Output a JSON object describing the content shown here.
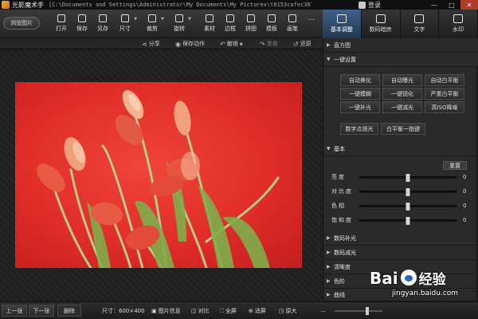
{
  "titlebar": {
    "app_name": "光影魔术手",
    "path": "[C:\\Documents and Settings\\Administrator\\My Documents\\My Pictures\\t0153cafec36754c...",
    "login": "登录",
    "min": "—",
    "max": "□",
    "close": "✕"
  },
  "toolbar": {
    "browse_label": "浏览图片",
    "tools": [
      {
        "label": "打开",
        "icon": "folder-icon"
      },
      {
        "label": "保存",
        "icon": "save-icon"
      },
      {
        "label": "另存",
        "icon": "save-as-icon"
      },
      {
        "label": "尺寸",
        "icon": "resize-icon"
      },
      {
        "label": "裁剪",
        "icon": "crop-icon"
      },
      {
        "label": "旋转",
        "icon": "rotate-icon"
      },
      {
        "label": "素材",
        "icon": "material-icon"
      },
      {
        "label": "边框",
        "icon": "border-icon"
      },
      {
        "label": "拼图",
        "icon": "collage-icon"
      },
      {
        "label": "模板",
        "icon": "template-icon"
      },
      {
        "label": "画笔",
        "icon": "brush-icon"
      },
      {
        "label": "...",
        "icon": "more-icon"
      }
    ]
  },
  "right_tabs": [
    {
      "label": "基本调整",
      "icon": "adjust-icon",
      "active": true
    },
    {
      "label": "数码暗房",
      "icon": "camera-icon",
      "active": false
    },
    {
      "label": "文字",
      "icon": "text-icon",
      "active": false
    },
    {
      "label": "水印",
      "icon": "watermark-icon",
      "active": false
    }
  ],
  "actionbar": {
    "share": "分享",
    "save_action": "保存动作",
    "undo": "撤销",
    "redo": "重做",
    "restore": "还原"
  },
  "panel": {
    "histogram": "直方图",
    "one_click": "一键设置",
    "buttons": [
      "自动美化",
      "自动曝光",
      "自动白平衡",
      "一键模糊",
      "一键锐化",
      "严重白平衡",
      "一键补光",
      "一键减光",
      "高ISO降噪",
      "数字点测光",
      "白平衡一指键"
    ],
    "basic": "基本",
    "reset": "重置",
    "sliders": [
      {
        "label": "亮度",
        "value": 0
      },
      {
        "label": "对比度",
        "value": 0
      },
      {
        "label": "色相",
        "value": 0
      },
      {
        "label": "饱和度",
        "value": 0
      }
    ],
    "sections": [
      "数码补光",
      "数码减光",
      "清晰度",
      "色阶",
      "曲线"
    ]
  },
  "statusbar": {
    "prev": "上一张",
    "next": "下一张",
    "delete": "删除",
    "size": "尺寸：600×400",
    "info": "图片信息",
    "compare": "对比",
    "fullscreen": "全屏",
    "fit": "适屏",
    "original": "原大",
    "zoom_level": 0.65
  },
  "watermark": {
    "brand": "Bai",
    "brand2": "经验",
    "url": "jingyan.baidu.com"
  },
  "colors": {
    "accent": "#3f5f8a",
    "photo_bg": "#e02d28"
  }
}
